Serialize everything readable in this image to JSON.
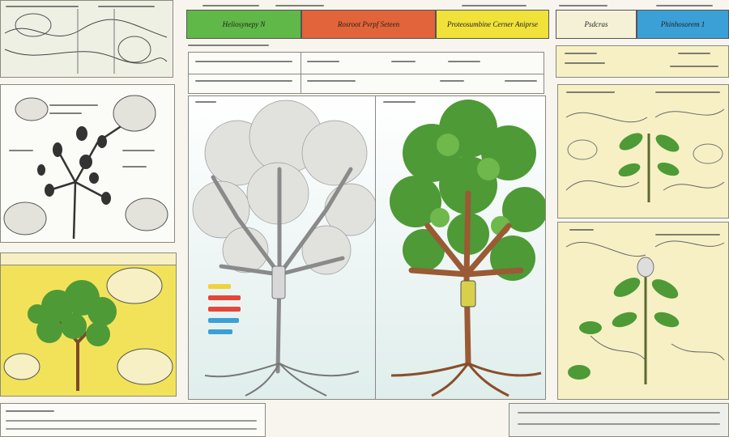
{
  "tabs": [
    {
      "label": "Heliosynepy N",
      "color": "#5fb847"
    },
    {
      "label": "Rosroot  Pvrpf Seteen",
      "color": "#e2643a"
    },
    {
      "label": "Proteosumbine Cerner  Aniprse",
      "color": "#f1e23a"
    },
    {
      "label": "Psdcras",
      "color": "#f4f1d6"
    },
    {
      "label": "Phinhosorem 1",
      "color": "#3ba0d6"
    }
  ],
  "colors": {
    "paper": "#f7f5ee",
    "yellow": "#f2e25a",
    "cream": "#f6f0c4",
    "leaf": "#4e9a36",
    "trunk": "#9a5a34",
    "grey-tree": "#9a9a9a"
  },
  "legend_bars": [
    {
      "color": "#f0d23a"
    },
    {
      "color": "#e6453a"
    },
    {
      "color": "#e6453a"
    },
    {
      "color": "#3ba0d6"
    },
    {
      "color": "#3ba0d6"
    }
  ]
}
